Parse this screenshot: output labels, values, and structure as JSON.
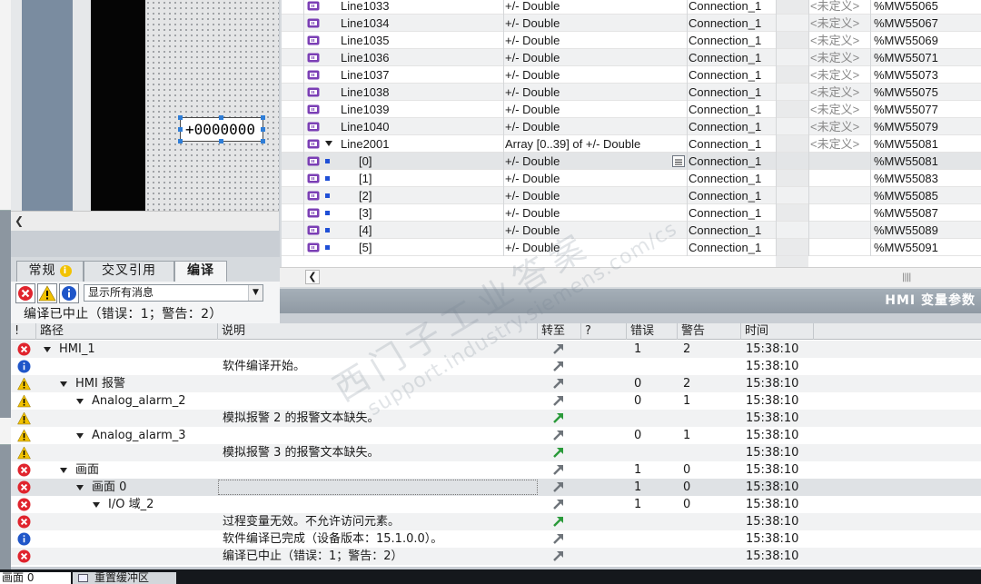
{
  "canvas": {
    "io_field_value": "+0000000"
  },
  "inspector": {
    "tabs": [
      {
        "label": "常规",
        "active": false
      },
      {
        "label": "交叉引用",
        "active": false
      },
      {
        "label": "编译",
        "active": true
      }
    ],
    "filter_value": "显示所有消息",
    "summary": "编译已中止（错误：1；警告：2）"
  },
  "tag_table": {
    "title": "HMI 变量参数",
    "rows": [
      {
        "name": "Line1033",
        "type": "+/- Double",
        "conn": "Connection_1",
        "acq": "<未定义>",
        "addr": "%MW55065",
        "kind": "tag"
      },
      {
        "name": "Line1034",
        "type": "+/- Double",
        "conn": "Connection_1",
        "acq": "<未定义>",
        "addr": "%MW55067",
        "kind": "tag"
      },
      {
        "name": "Line1035",
        "type": "+/- Double",
        "conn": "Connection_1",
        "acq": "<未定义>",
        "addr": "%MW55069",
        "kind": "tag"
      },
      {
        "name": "Line1036",
        "type": "+/- Double",
        "conn": "Connection_1",
        "acq": "<未定义>",
        "addr": "%MW55071",
        "kind": "tag"
      },
      {
        "name": "Line1037",
        "type": "+/- Double",
        "conn": "Connection_1",
        "acq": "<未定义>",
        "addr": "%MW55073",
        "kind": "tag"
      },
      {
        "name": "Line1038",
        "type": "+/- Double",
        "conn": "Connection_1",
        "acq": "<未定义>",
        "addr": "%MW55075",
        "kind": "tag"
      },
      {
        "name": "Line1039",
        "type": "+/- Double",
        "conn": "Connection_1",
        "acq": "<未定义>",
        "addr": "%MW55077",
        "kind": "tag"
      },
      {
        "name": "Line1040",
        "type": "+/- Double",
        "conn": "Connection_1",
        "acq": "<未定义>",
        "addr": "%MW55079",
        "kind": "tag"
      },
      {
        "name": "Line2001",
        "type": "Array [0..39] of +/- Double",
        "conn": "Connection_1",
        "acq": "<未定义>",
        "addr": "%MW55081",
        "kind": "array"
      },
      {
        "name": "[0]",
        "type": "+/- Double",
        "conn": "Connection_1",
        "acq": "",
        "addr": "%MW55081",
        "kind": "element"
      },
      {
        "name": "[1]",
        "type": "+/- Double",
        "conn": "Connection_1",
        "acq": "",
        "addr": "%MW55083",
        "kind": "element"
      },
      {
        "name": "[2]",
        "type": "+/- Double",
        "conn": "Connection_1",
        "acq": "",
        "addr": "%MW55085",
        "kind": "element"
      },
      {
        "name": "[3]",
        "type": "+/- Double",
        "conn": "Connection_1",
        "acq": "",
        "addr": "%MW55087",
        "kind": "element"
      },
      {
        "name": "[4]",
        "type": "+/- Double",
        "conn": "Connection_1",
        "acq": "",
        "addr": "%MW55089",
        "kind": "element"
      },
      {
        "name": "[5]",
        "type": "+/- Double",
        "conn": "Connection_1",
        "acq": "",
        "addr": "%MW55091",
        "kind": "element"
      }
    ]
  },
  "messages": {
    "columns": {
      "flag": "!",
      "path": "路径",
      "desc": "说明",
      "goto": "转至",
      "q": "?",
      "errors": "错误",
      "warnings": "警告",
      "time": "时间"
    },
    "rows": [
      {
        "icon": "error",
        "depth": 0,
        "expand": true,
        "path": "HMI_1",
        "desc": "",
        "goto": "grey",
        "errors": "1",
        "warnings": "2",
        "time": "15:38:10"
      },
      {
        "icon": "info",
        "depth": 0,
        "expand": false,
        "path": "",
        "desc": "软件编译开始。",
        "goto": "grey",
        "errors": "",
        "warnings": "",
        "time": "15:38:10"
      },
      {
        "icon": "warning",
        "depth": 1,
        "expand": true,
        "path": "HMI 报警",
        "desc": "",
        "goto": "grey",
        "errors": "0",
        "warnings": "2",
        "time": "15:38:10"
      },
      {
        "icon": "warning",
        "depth": 2,
        "expand": true,
        "path": "Analog_alarm_2",
        "desc": "",
        "goto": "grey",
        "errors": "0",
        "warnings": "1",
        "time": "15:38:10"
      },
      {
        "icon": "warning",
        "depth": 3,
        "expand": false,
        "path": "",
        "desc": "模拟报警 2 的报警文本缺失。",
        "goto": "green",
        "errors": "",
        "warnings": "",
        "time": "15:38:10"
      },
      {
        "icon": "warning",
        "depth": 2,
        "expand": true,
        "path": "Analog_alarm_3",
        "desc": "",
        "goto": "grey",
        "errors": "0",
        "warnings": "1",
        "time": "15:38:10"
      },
      {
        "icon": "warning",
        "depth": 3,
        "expand": false,
        "path": "",
        "desc": "模拟报警 3 的报警文本缺失。",
        "goto": "green",
        "errors": "",
        "warnings": "",
        "time": "15:38:10"
      },
      {
        "icon": "error",
        "depth": 1,
        "expand": true,
        "path": "画面",
        "desc": "",
        "goto": "grey",
        "errors": "1",
        "warnings": "0",
        "time": "15:38:10"
      },
      {
        "icon": "error",
        "depth": 2,
        "expand": true,
        "path": "画面 0",
        "desc": "",
        "goto": "grey",
        "errors": "1",
        "warnings": "0",
        "time": "15:38:10"
      },
      {
        "icon": "error",
        "depth": 3,
        "expand": true,
        "path": "I/O 域_2",
        "desc": "",
        "goto": "grey",
        "errors": "1",
        "warnings": "0",
        "time": "15:38:10"
      },
      {
        "icon": "error",
        "depth": 4,
        "expand": false,
        "path": "",
        "desc": "过程变量无效。不允许访问元素。",
        "goto": "green",
        "errors": "",
        "warnings": "",
        "time": "15:38:10"
      },
      {
        "icon": "info",
        "depth": 0,
        "expand": false,
        "path": "",
        "desc": "软件编译已完成（设备版本：15.1.0.0）。",
        "goto": "grey",
        "errors": "",
        "warnings": "",
        "time": "15:38:10"
      },
      {
        "icon": "error",
        "depth": 0,
        "expand": false,
        "path": "",
        "desc": "编译已中止（错误：1；警告：2）",
        "goto": "grey",
        "errors": "",
        "warnings": "",
        "time": "15:38:10"
      }
    ]
  },
  "bottom": {
    "tab1": "画面 0",
    "tab2": "重置缓冲区"
  },
  "watermark": {
    "line1": "西门子工业答案",
    "line2": "support.industry.siemens.com/cs"
  },
  "colors": {
    "error": "#e0242d",
    "warning": "#f2c200",
    "info": "#1f56c9",
    "goto_green": "#2a9a3a",
    "goto_grey": "#6e747a",
    "tag_icon": "#7b3fb5"
  }
}
